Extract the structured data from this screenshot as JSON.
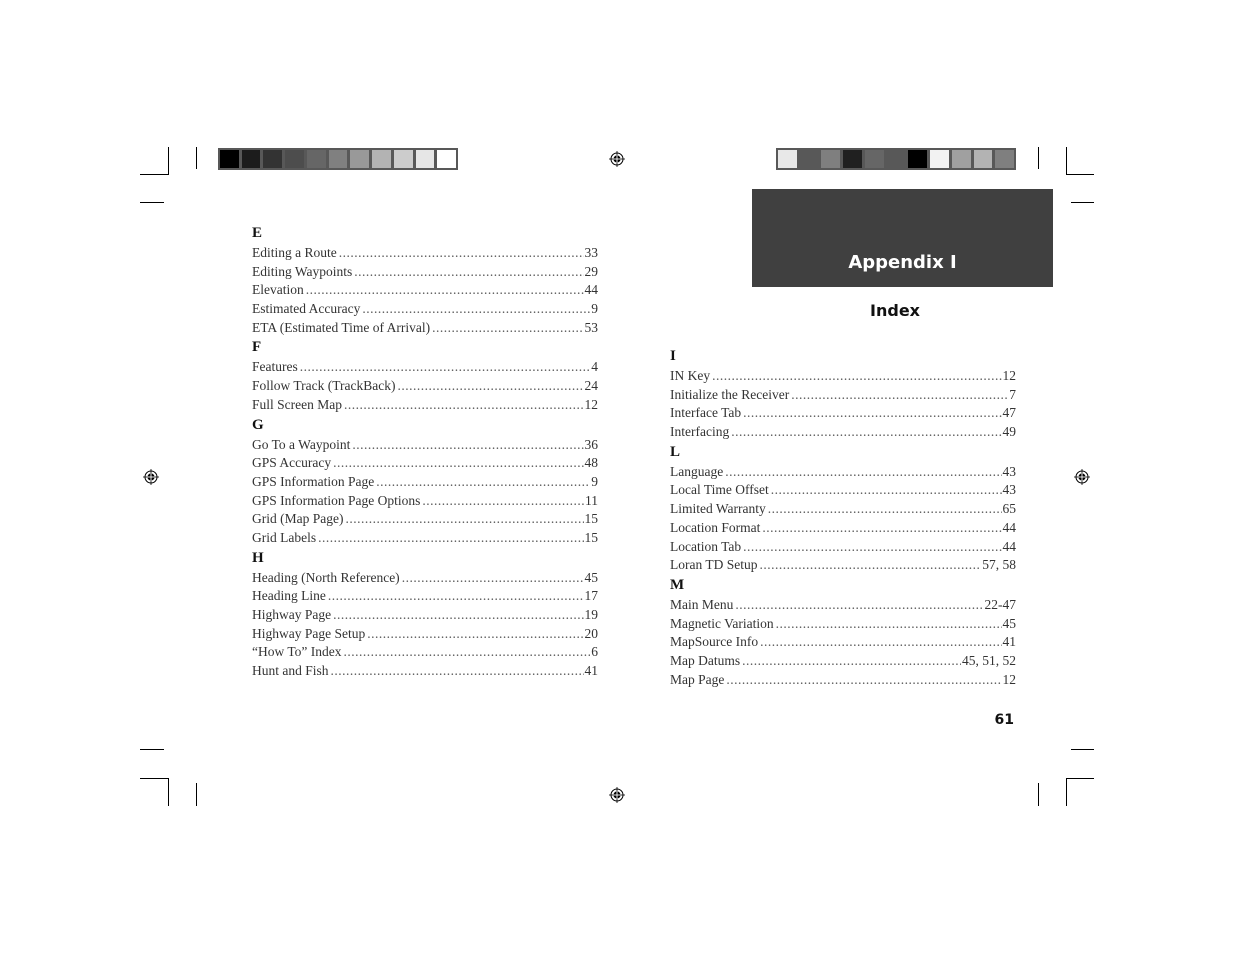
{
  "header": {
    "section_title": "Appendix I",
    "subtitle": "Index"
  },
  "page_number": "61",
  "color_strips": {
    "left": [
      "#000000",
      "#1c1c1c",
      "#333333",
      "#4d4d4d",
      "#666666",
      "#808080",
      "#999999",
      "#b3b3b3",
      "#cccccc",
      "#e6e6e6",
      "#ffffff"
    ],
    "right": [
      "#e8e8e8",
      "#585858",
      "#7f7f7f",
      "#202020",
      "#666666",
      "#585858",
      "#000000",
      "#f2f2f2",
      "#a0a0a0",
      "#b3b3b3",
      "#7f7f7f"
    ]
  },
  "left_column": [
    {
      "letter": "E",
      "entries": [
        {
          "term": "Editing a Route",
          "pages": "33"
        },
        {
          "term": "Editing Waypoints",
          "pages": "29"
        },
        {
          "term": "Elevation",
          "pages": "44"
        },
        {
          "term": "Estimated Accuracy",
          "pages": "9"
        },
        {
          "term": "ETA (Estimated Time of Arrival)",
          "pages": "53"
        }
      ]
    },
    {
      "letter": "F",
      "entries": [
        {
          "term": "Features",
          "pages": "4"
        },
        {
          "term": "Follow Track (TrackBack)",
          "pages": "24"
        },
        {
          "term": "Full Screen Map",
          "pages": "12"
        }
      ]
    },
    {
      "letter": "G",
      "entries": [
        {
          "term": "Go To a Waypoint",
          "pages": "36"
        },
        {
          "term": "GPS Accuracy",
          "pages": "48"
        },
        {
          "term": "GPS Information Page",
          "pages": "9"
        },
        {
          "term": "GPS Information Page Options",
          "pages": "11"
        },
        {
          "term": "Grid (Map Page)",
          "pages": "15"
        },
        {
          "term": "Grid Labels",
          "pages": "15"
        }
      ]
    },
    {
      "letter": "H",
      "entries": [
        {
          "term": "Heading (North Reference)",
          "pages": "45"
        },
        {
          "term": "Heading Line",
          "pages": "17"
        },
        {
          "term": "Highway Page",
          "pages": "19"
        },
        {
          "term": "Highway Page Setup",
          "pages": "20"
        },
        {
          "term": "“How To” Index",
          "pages": "6"
        },
        {
          "term": "Hunt and Fish",
          "pages": "41"
        }
      ]
    }
  ],
  "right_column": [
    {
      "letter": "I",
      "entries": [
        {
          "term": "IN Key",
          "pages": "12"
        },
        {
          "term": "Initialize the Receiver",
          "pages": "7"
        },
        {
          "term": "Interface Tab",
          "pages": "47"
        },
        {
          "term": "Interfacing",
          "pages": "49"
        }
      ]
    },
    {
      "letter": "L",
      "entries": [
        {
          "term": "Language",
          "pages": "43"
        },
        {
          "term": "Local Time Offset",
          "pages": "43"
        },
        {
          "term": "Limited Warranty",
          "pages": "65"
        },
        {
          "term": "Location Format",
          "pages": "44"
        },
        {
          "term": "Location Tab",
          "pages": "44"
        },
        {
          "term": "Loran TD Setup",
          "pages": "57, 58"
        }
      ]
    },
    {
      "letter": "M",
      "entries": [
        {
          "term": "Main Menu",
          "pages": "22-47"
        },
        {
          "term": "Magnetic Variation",
          "pages": "45"
        },
        {
          "term": "MapSource Info",
          "pages": "41"
        },
        {
          "term": "Map Datums",
          "pages": "45, 51, 52"
        },
        {
          "term": "Map Page",
          "pages": "12"
        }
      ]
    }
  ]
}
